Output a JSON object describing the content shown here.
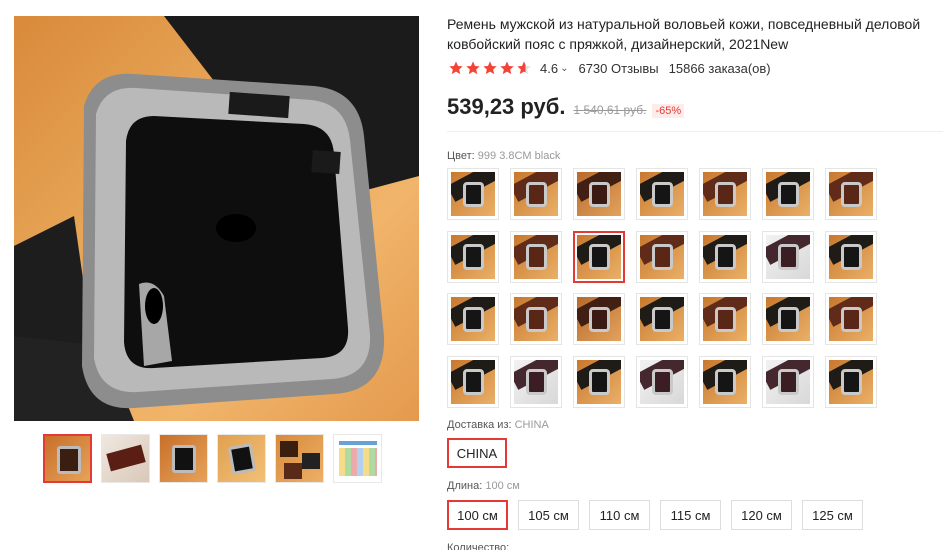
{
  "product": {
    "title": "Ремень мужской из натуральной воловьей кожи, повседневный деловой ковбойский пояс с пряжкой, дизайнерский, 2021New",
    "rating": "4.6",
    "rating_stars": 4.6,
    "reviews": "6730 Отзывы",
    "orders": "15866 заказа(ов)",
    "price": "539,23 руб.",
    "old_price": "1 540,61 руб.",
    "discount": "-65%"
  },
  "colors": {
    "accent": "#e53935",
    "star": "#f44336"
  },
  "gallery": {
    "selected_index": 0,
    "thumb_count": 6
  },
  "color_section": {
    "label": "Цвет:",
    "value": "999 3.8CM black",
    "selected_index": 9,
    "swatches": [
      "black",
      "brown",
      "dark-brown",
      "black",
      "brown",
      "black",
      "brown",
      "black",
      "brown",
      "black",
      "brown",
      "black",
      "coffee",
      "black",
      "black",
      "brown",
      "dark-brown",
      "black",
      "brown",
      "black",
      "brown",
      "black",
      "coffee",
      "black",
      "coffee",
      "black",
      "coffee",
      "black"
    ]
  },
  "shipping": {
    "label": "Доставка из:",
    "value": "CHINA",
    "options": [
      "CHINA"
    ]
  },
  "length": {
    "label": "Длина:",
    "value": "100 см",
    "options": [
      "100 см",
      "105 см",
      "110 см",
      "115 см",
      "120 см",
      "125 см"
    ]
  },
  "quantity": {
    "label": "Количество:"
  }
}
